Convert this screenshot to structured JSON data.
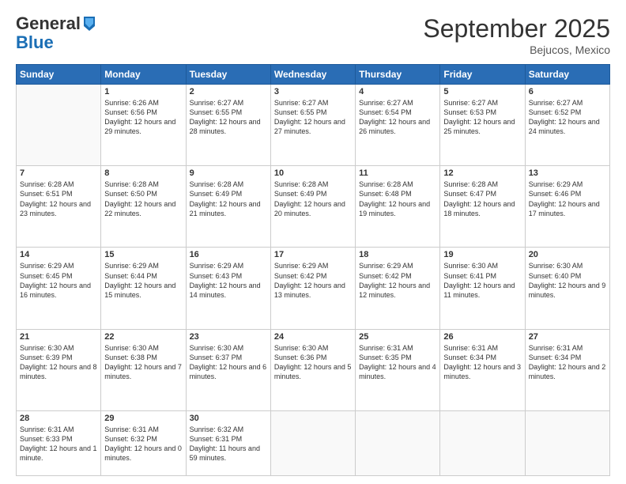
{
  "logo": {
    "line1": "General",
    "line2": "Blue"
  },
  "header": {
    "month": "September 2025",
    "location": "Bejucos, Mexico"
  },
  "days": [
    "Sunday",
    "Monday",
    "Tuesday",
    "Wednesday",
    "Thursday",
    "Friday",
    "Saturday"
  ],
  "weeks": [
    [
      {
        "num": "",
        "empty": true
      },
      {
        "num": "1",
        "rise": "6:26 AM",
        "set": "6:56 PM",
        "daylight": "12 hours and 29 minutes."
      },
      {
        "num": "2",
        "rise": "6:27 AM",
        "set": "6:55 PM",
        "daylight": "12 hours and 28 minutes."
      },
      {
        "num": "3",
        "rise": "6:27 AM",
        "set": "6:55 PM",
        "daylight": "12 hours and 27 minutes."
      },
      {
        "num": "4",
        "rise": "6:27 AM",
        "set": "6:54 PM",
        "daylight": "12 hours and 26 minutes."
      },
      {
        "num": "5",
        "rise": "6:27 AM",
        "set": "6:53 PM",
        "daylight": "12 hours and 25 minutes."
      },
      {
        "num": "6",
        "rise": "6:27 AM",
        "set": "6:52 PM",
        "daylight": "12 hours and 24 minutes."
      }
    ],
    [
      {
        "num": "7",
        "rise": "6:28 AM",
        "set": "6:51 PM",
        "daylight": "12 hours and 23 minutes."
      },
      {
        "num": "8",
        "rise": "6:28 AM",
        "set": "6:50 PM",
        "daylight": "12 hours and 22 minutes."
      },
      {
        "num": "9",
        "rise": "6:28 AM",
        "set": "6:49 PM",
        "daylight": "12 hours and 21 minutes."
      },
      {
        "num": "10",
        "rise": "6:28 AM",
        "set": "6:49 PM",
        "daylight": "12 hours and 20 minutes."
      },
      {
        "num": "11",
        "rise": "6:28 AM",
        "set": "6:48 PM",
        "daylight": "12 hours and 19 minutes."
      },
      {
        "num": "12",
        "rise": "6:28 AM",
        "set": "6:47 PM",
        "daylight": "12 hours and 18 minutes."
      },
      {
        "num": "13",
        "rise": "6:29 AM",
        "set": "6:46 PM",
        "daylight": "12 hours and 17 minutes."
      }
    ],
    [
      {
        "num": "14",
        "rise": "6:29 AM",
        "set": "6:45 PM",
        "daylight": "12 hours and 16 minutes."
      },
      {
        "num": "15",
        "rise": "6:29 AM",
        "set": "6:44 PM",
        "daylight": "12 hours and 15 minutes."
      },
      {
        "num": "16",
        "rise": "6:29 AM",
        "set": "6:43 PM",
        "daylight": "12 hours and 14 minutes."
      },
      {
        "num": "17",
        "rise": "6:29 AM",
        "set": "6:42 PM",
        "daylight": "12 hours and 13 minutes."
      },
      {
        "num": "18",
        "rise": "6:29 AM",
        "set": "6:42 PM",
        "daylight": "12 hours and 12 minutes."
      },
      {
        "num": "19",
        "rise": "6:30 AM",
        "set": "6:41 PM",
        "daylight": "12 hours and 11 minutes."
      },
      {
        "num": "20",
        "rise": "6:30 AM",
        "set": "6:40 PM",
        "daylight": "12 hours and 9 minutes."
      }
    ],
    [
      {
        "num": "21",
        "rise": "6:30 AM",
        "set": "6:39 PM",
        "daylight": "12 hours and 8 minutes."
      },
      {
        "num": "22",
        "rise": "6:30 AM",
        "set": "6:38 PM",
        "daylight": "12 hours and 7 minutes."
      },
      {
        "num": "23",
        "rise": "6:30 AM",
        "set": "6:37 PM",
        "daylight": "12 hours and 6 minutes."
      },
      {
        "num": "24",
        "rise": "6:30 AM",
        "set": "6:36 PM",
        "daylight": "12 hours and 5 minutes."
      },
      {
        "num": "25",
        "rise": "6:31 AM",
        "set": "6:35 PM",
        "daylight": "12 hours and 4 minutes."
      },
      {
        "num": "26",
        "rise": "6:31 AM",
        "set": "6:34 PM",
        "daylight": "12 hours and 3 minutes."
      },
      {
        "num": "27",
        "rise": "6:31 AM",
        "set": "6:34 PM",
        "daylight": "12 hours and 2 minutes."
      }
    ],
    [
      {
        "num": "28",
        "rise": "6:31 AM",
        "set": "6:33 PM",
        "daylight": "12 hours and 1 minute."
      },
      {
        "num": "29",
        "rise": "6:31 AM",
        "set": "6:32 PM",
        "daylight": "12 hours and 0 minutes."
      },
      {
        "num": "30",
        "rise": "6:32 AM",
        "set": "6:31 PM",
        "daylight": "11 hours and 59 minutes."
      },
      {
        "num": "",
        "empty": true
      },
      {
        "num": "",
        "empty": true
      },
      {
        "num": "",
        "empty": true
      },
      {
        "num": "",
        "empty": true
      }
    ]
  ]
}
